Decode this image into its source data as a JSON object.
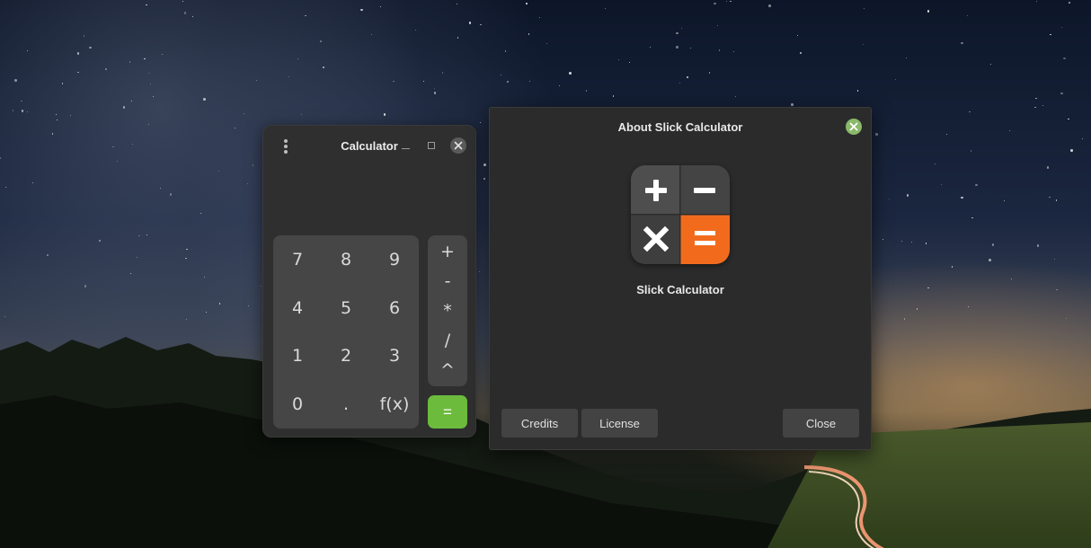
{
  "calculator": {
    "title": "Calculator",
    "display_value": "",
    "number_keys": [
      "7",
      "8",
      "9",
      "4",
      "5",
      "6",
      "1",
      "2",
      "3",
      "0",
      ".",
      "f(x)"
    ],
    "operator_keys": [
      "+",
      "-",
      "*",
      "/",
      "^"
    ],
    "equals_key": "=",
    "accent_color": "#6cbb3c"
  },
  "about_dialog": {
    "title": "About Slick Calculator",
    "app_name": "Slick Calculator",
    "buttons": {
      "credits": "Credits",
      "license": "License",
      "close": "Close"
    },
    "icon_colors": {
      "dark": "#4a4a4a",
      "orange": "#f26b1d"
    },
    "close_color": "#8ab96a"
  },
  "icons": {
    "app_icon": "calculator-app-icon",
    "menu": "kebab-menu-icon",
    "minimize": "minimize-icon",
    "maximize": "maximize-icon",
    "close": "close-icon"
  }
}
